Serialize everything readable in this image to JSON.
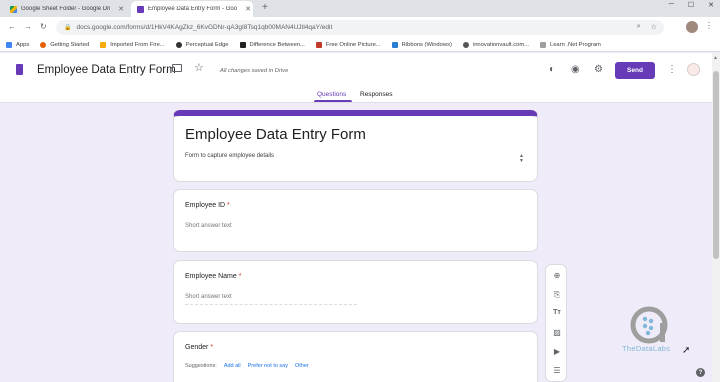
{
  "browser": {
    "tabs": [
      {
        "title": "Google Sheet Folder - Google Dri",
        "icon": "drive-icon",
        "active": false
      },
      {
        "title": "Employee Data Entry Form - Goo",
        "icon": "forms-icon",
        "active": true
      }
    ],
    "url": "docs.google.com/forms/d/1HkV4KAgZkz_6KvGDNr-qA3gI8Tsq1qb00MAN4UJtl4qaY/edit",
    "bookmarks": [
      {
        "label": "Apps",
        "color": "#4285f4"
      },
      {
        "label": "Getting Started",
        "color": "#e66000"
      },
      {
        "label": "Imported From Fire...",
        "color": "#f9ab00"
      },
      {
        "label": "Perceptual Edge",
        "color": "#333333"
      },
      {
        "label": "Difference Between...",
        "color": "#222222"
      },
      {
        "label": "Free Online Picture...",
        "color": "#c0392b"
      },
      {
        "label": "Ribbons (Windows)",
        "color": "#2b7cd3"
      },
      {
        "label": "innovationvault.com...",
        "color": "#555555"
      },
      {
        "label": "Learn .Net Program",
        "color": "#9e9e9e"
      }
    ]
  },
  "appbar": {
    "doc_title": "Employee Data Entry Form",
    "saved_status": "All changes saved in Drive",
    "send_label": "Send",
    "tabs": [
      "Questions",
      "Responses"
    ],
    "accent": "#673ab7"
  },
  "form": {
    "title": "Employee Data Entry Form",
    "description": "Form to capture employee details",
    "questions": [
      {
        "title": "Employee ID",
        "required": "*",
        "answer_hint": "Short answer text"
      },
      {
        "title": "Employee Name",
        "required": "*",
        "answer_hint": "Short answer text"
      },
      {
        "title": "Gender",
        "required": "*",
        "suggestions_label": "Suggestions:",
        "suggestions": [
          "Add all",
          "Prefer not to say",
          "Other"
        ]
      }
    ]
  },
  "side_toolbar": {
    "icons": [
      "add-question-icon",
      "import-questions-icon",
      "add-title-icon",
      "add-image-icon",
      "add-video-icon",
      "add-section-icon"
    ]
  },
  "watermark": {
    "text": "TheDataLabs"
  }
}
